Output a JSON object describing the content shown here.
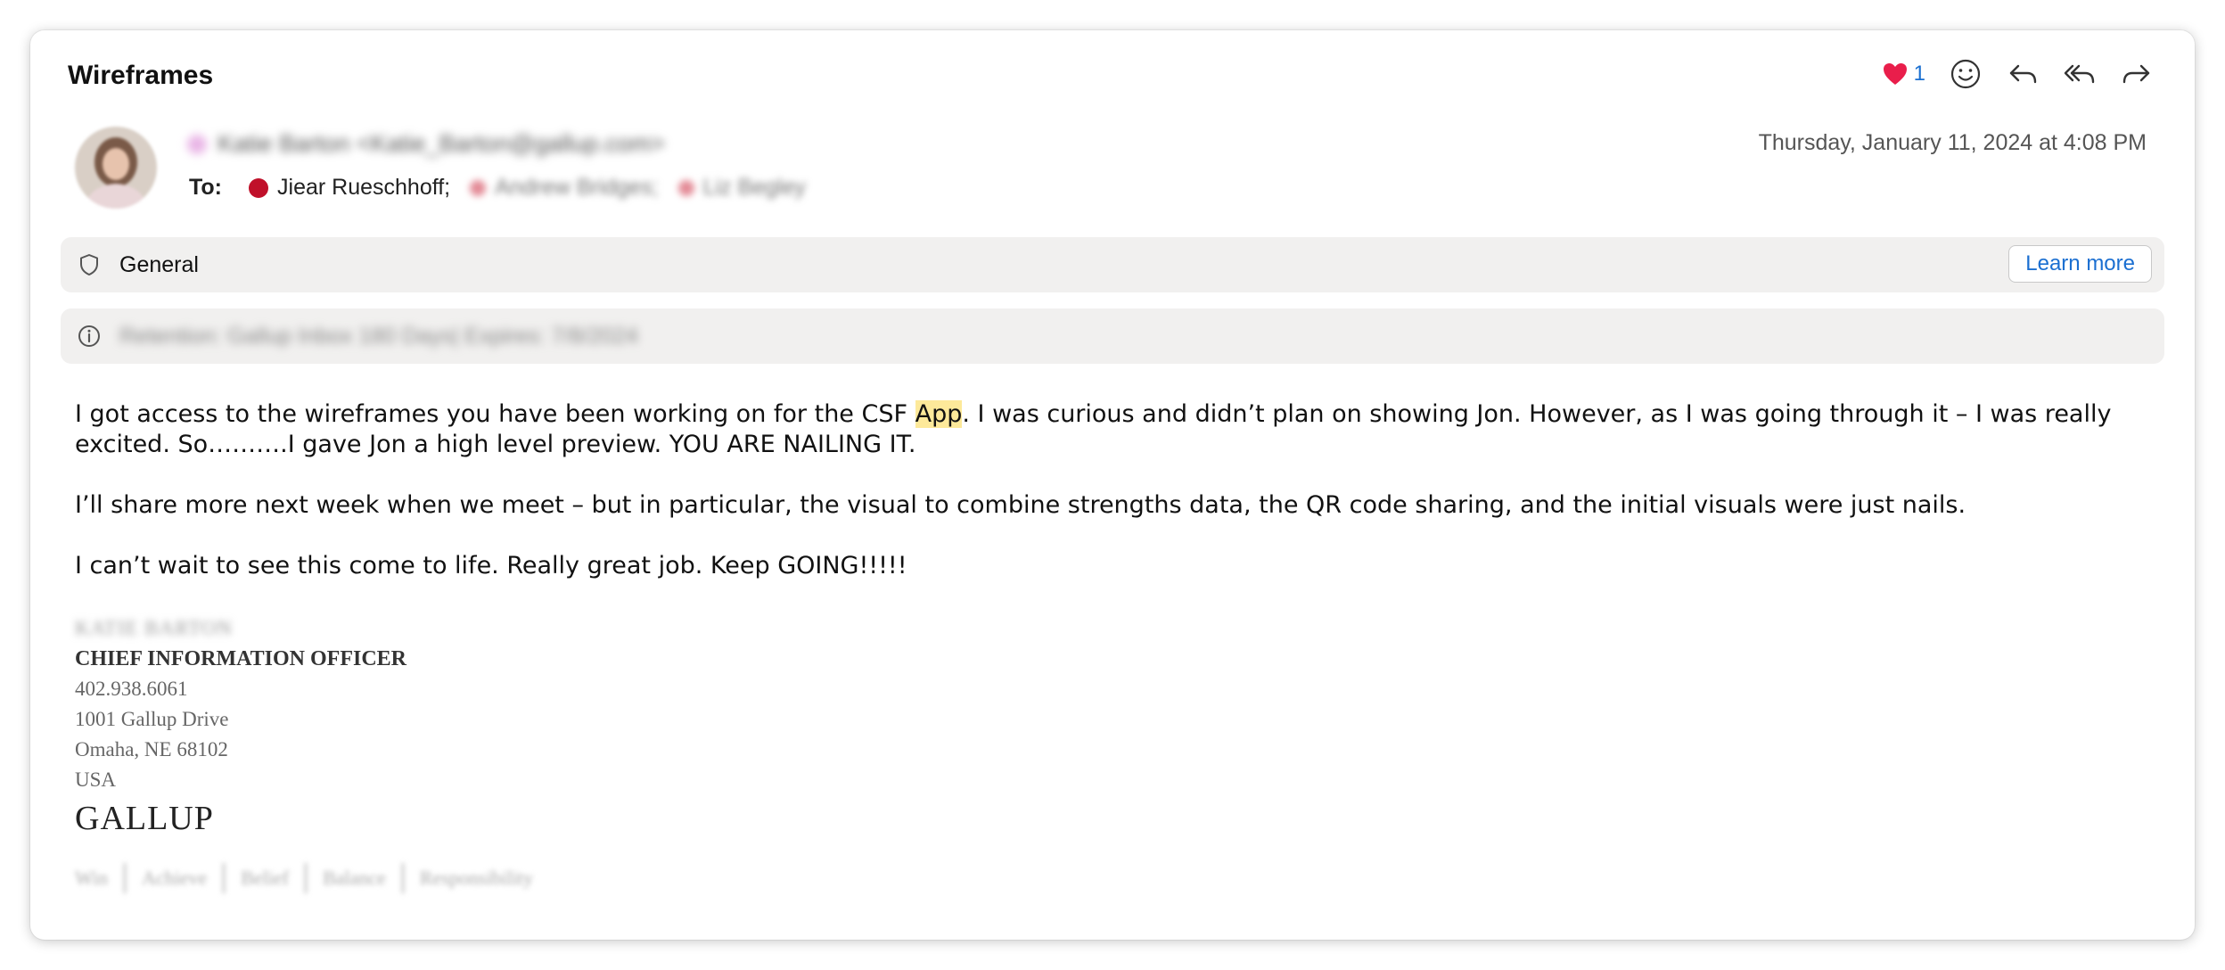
{
  "message": {
    "subject": "Wireframes",
    "reaction_count": "1",
    "from_display": "Katie Barton <Katie_Barton@gallup.com>",
    "to_label": "To:",
    "recipients": {
      "primary": "Jiear Rueschhoff;",
      "second": "Andrew Bridges;",
      "third": "Liz Begley"
    },
    "date": "Thursday, January 11, 2024 at 4:08 PM",
    "colors": {
      "heart": "#e91e4b",
      "accent": "#1b6fd1",
      "recipient_dot": "#c0102a",
      "highlight": "#fde99a"
    }
  },
  "banners": {
    "sensitivity": "General",
    "learn_more": "Learn more",
    "retention": "Retention: Gallup Inbox 180 Days| Expires: 7/8/2024"
  },
  "body": {
    "p1_before": "I got access to the wireframes you have been working on for the CSF ",
    "p1_highlight": "App",
    "p1_after": ". I was curious and didn’t plan on showing Jon. However, as I was going through it – I was really excited. So……….I gave Jon a high level preview.  YOU ARE NAILING IT.",
    "p2": "I’ll share more next week when we meet – but in particular, the visual to combine strengths data, the QR code sharing, and the initial visuals were just nails.",
    "p3": "I can’t wait to see this come to life. Really great job. Keep GOING!!!!!"
  },
  "signature": {
    "name": "KATIE BARTON",
    "title": "CHIEF INFORMATION OFFICER",
    "phone": "402.938.6061",
    "address1": "1001 Gallup Drive",
    "address2": "Omaha, NE  68102",
    "country": "USA",
    "logo": "GALLUP",
    "values": [
      "Win",
      "Achieve",
      "Belief",
      "Balance",
      "Responsibility"
    ]
  },
  "icons": {
    "reaction": "heart-icon",
    "emoji": "smiley-icon",
    "reply": "reply-icon",
    "reply_all": "reply-all-icon",
    "forward": "forward-icon",
    "sensitivity": "shield-icon",
    "retention": "info-icon"
  }
}
